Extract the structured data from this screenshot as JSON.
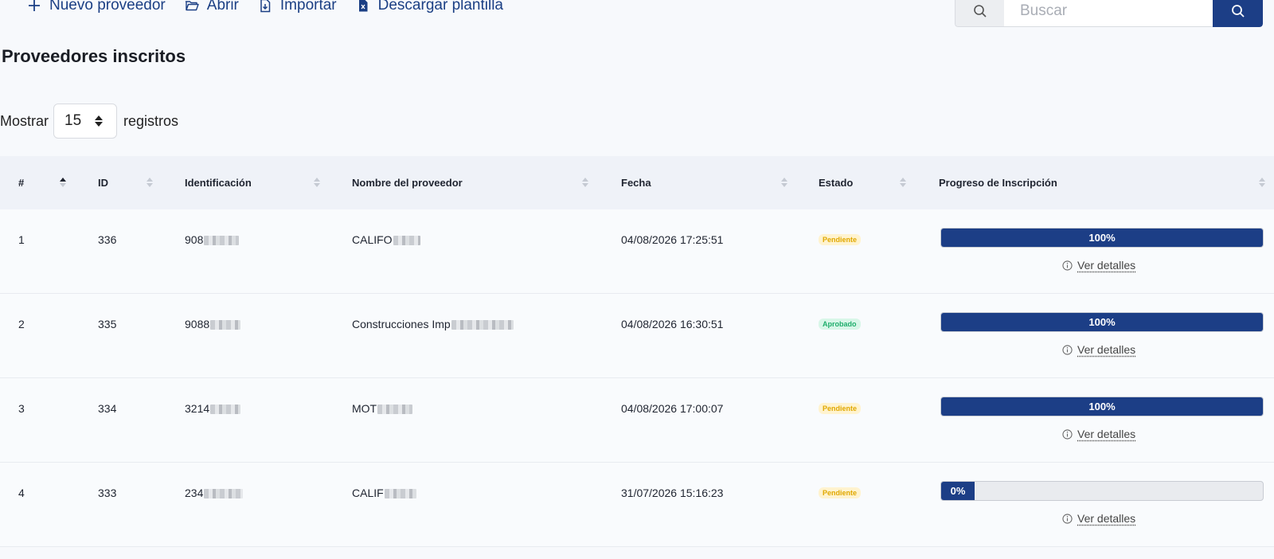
{
  "toolbar": {
    "new_label": "Nuevo proveedor",
    "open_label": "Abrir",
    "import_label": "Importar",
    "template_label": "Descargar plantilla",
    "search_placeholder": "Buscar"
  },
  "page_title": "Proveedores inscritos",
  "length": {
    "prefix": "Mostrar",
    "value": "15",
    "suffix": "registros"
  },
  "columns": {
    "num": "#",
    "id": "ID",
    "identification": "Identificación",
    "name": "Nombre del proveedor",
    "date": "Fecha",
    "status": "Estado",
    "progress": "Progreso de Inscripción"
  },
  "rows": [
    {
      "num": "1",
      "id": "336",
      "identification": "908",
      "name": "CALIFO",
      "date": "04/08/2026 17:25:51",
      "status": "Pendiente",
      "progress": 100,
      "progress_label": "100%",
      "details": "Ver detalles"
    },
    {
      "num": "2",
      "id": "335",
      "identification": "9088",
      "name": "Construcciones Imp",
      "date": "04/08/2026 16:30:51",
      "status": "Aprobado",
      "progress": 100,
      "progress_label": "100%",
      "details": "Ver detalles"
    },
    {
      "num": "3",
      "id": "334",
      "identification": "3214",
      "name": "MOT",
      "date": "04/08/2026 17:00:07",
      "status": "Pendiente",
      "progress": 100,
      "progress_label": "100%",
      "details": "Ver detalles"
    },
    {
      "num": "4",
      "id": "333",
      "identification": "234",
      "name": "CALIF",
      "date": "31/07/2026 15:16:23",
      "status": "Pendiente",
      "progress": 0,
      "progress_label": "0%",
      "details": "Ver detalles"
    }
  ],
  "colors": {
    "primary": "#1c3e86",
    "pending_bg": "#fff3cf",
    "pending_text": "#e0a800",
    "approved_bg": "#d8f6e8",
    "approved_text": "#1fae6c"
  }
}
